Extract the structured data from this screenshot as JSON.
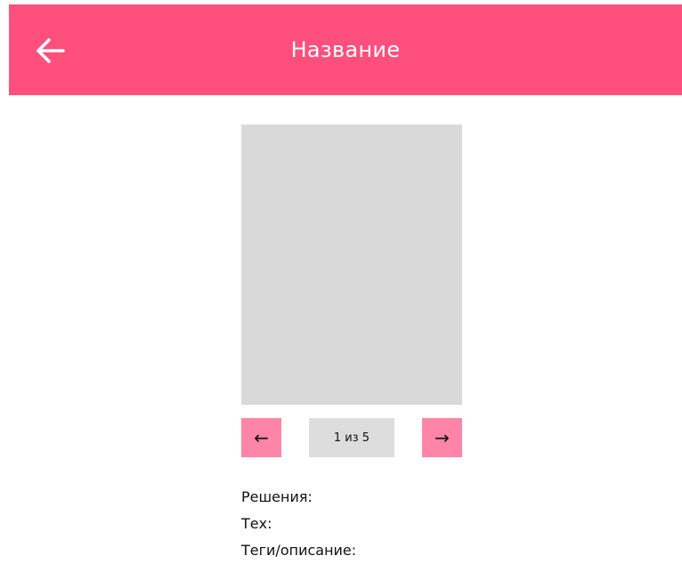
{
  "header": {
    "title": "Название",
    "back_icon": "arrow-left-icon",
    "background_color": "#ff4f7d"
  },
  "gallery": {
    "placeholder_color": "#d9d9d9",
    "prev_label": "←",
    "next_label": "→",
    "page_indicator": "1 из 5",
    "current_page": 1,
    "total_pages": 5,
    "button_color": "#ff85a8"
  },
  "info": {
    "solutions_label": "Решения:",
    "tech_label": "Тех:",
    "tags_label": "Теги/описание:"
  }
}
